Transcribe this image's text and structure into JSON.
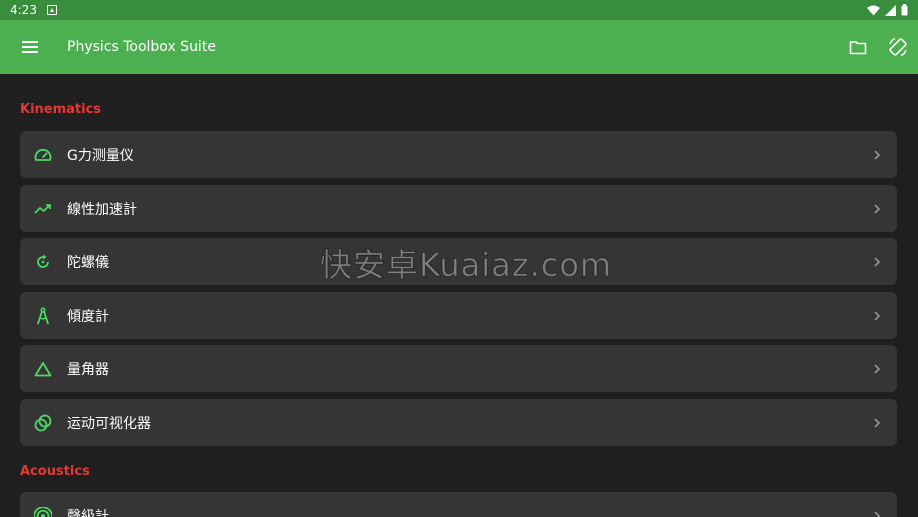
{
  "status_bar": {
    "time": "4:23"
  },
  "app_bar": {
    "title": "Physics Toolbox Suite"
  },
  "sections": [
    {
      "title": "Kinematics",
      "items": [
        {
          "label": "G力测量仪",
          "icon": "speedometer-icon"
        },
        {
          "label": "線性加速計",
          "icon": "trending-up-icon"
        },
        {
          "label": "陀螺儀",
          "icon": "rotate-icon"
        },
        {
          "label": "傾度計",
          "icon": "compass-drawing-icon"
        },
        {
          "label": "量角器",
          "icon": "triangle-icon"
        },
        {
          "label": "运动可视化器",
          "icon": "rings-icon"
        }
      ]
    },
    {
      "title": "Acoustics",
      "items": [
        {
          "label": "聲級計",
          "icon": "sound-level-icon"
        }
      ]
    }
  ],
  "watermark": "快安卓Kuaiaz.com",
  "colors": {
    "status_bar": "#388e3c",
    "app_bar": "#4caf50",
    "background": "#1f1f1f",
    "card": "#353535",
    "section_title": "#e53935",
    "icon_green": "#4cd964"
  }
}
